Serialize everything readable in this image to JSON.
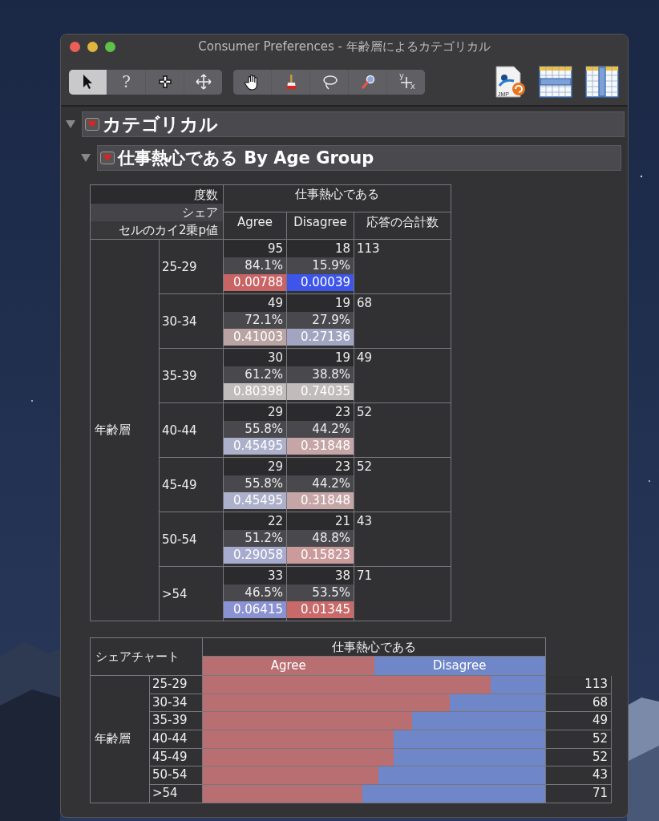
{
  "window": {
    "title": "Consumer Preferences - 年齢層によるカテゴリカル"
  },
  "tool_groups": [
    {
      "tools": [
        {
          "kind": "arrow",
          "selected": true
        },
        {
          "kind": "help",
          "glyph": "?",
          "selected": false
        },
        {
          "kind": "crosshair",
          "selected": false
        },
        {
          "kind": "move",
          "selected": false
        }
      ]
    },
    {
      "tools": [
        {
          "kind": "hand",
          "selected": false
        },
        {
          "kind": "brush",
          "selected": false
        },
        {
          "kind": "lasso",
          "selected": false
        },
        {
          "kind": "magnifier",
          "selected": false
        },
        {
          "kind": "xy",
          "sup": "y",
          "sub": "x",
          "selected": false
        }
      ]
    }
  ],
  "file_icons": [
    {
      "kind": "jmp",
      "label": "JMP"
    },
    {
      "kind": "rows"
    },
    {
      "kind": "columns"
    }
  ],
  "report": {
    "title": "カテゴリカル",
    "expanded": true,
    "section": {
      "title": "仕事熱心である By Age Group",
      "expanded": true
    }
  },
  "contingency_table": {
    "legend": [
      "度数",
      "シェア",
      "セルのカイ2乗p値"
    ],
    "column_header": "仕事熱心である",
    "columns": [
      "Agree",
      "Disagree"
    ],
    "total_header": "応答の合計数",
    "row_header": "年齢層",
    "rows": [
      {
        "label": "25-29",
        "total": "113",
        "cells": [
          {
            "count": "95",
            "share": "84.1%",
            "p_value": "0.00788",
            "color": "#c86464"
          },
          {
            "count": "18",
            "share": "15.9%",
            "p_value": "0.00039",
            "color": "#3d55e8"
          }
        ]
      },
      {
        "label": "30-34",
        "total": "68",
        "cells": [
          {
            "count": "49",
            "share": "72.1%",
            "p_value": "0.41003",
            "color": "#b9a3a3"
          },
          {
            "count": "19",
            "share": "27.9%",
            "p_value": "0.27136",
            "color": "#a2a5c2"
          }
        ]
      },
      {
        "label": "35-39",
        "total": "49",
        "cells": [
          {
            "count": "30",
            "share": "61.2%",
            "p_value": "0.80398",
            "color": "#c0bcbc"
          },
          {
            "count": "19",
            "share": "38.8%",
            "p_value": "0.74035",
            "color": "#c2bbbb"
          }
        ]
      },
      {
        "label": "40-44",
        "total": "52",
        "cells": [
          {
            "count": "29",
            "share": "55.8%",
            "p_value": "0.45495",
            "color": "#adb0ca"
          },
          {
            "count": "23",
            "share": "44.2%",
            "p_value": "0.31848",
            "color": "#c5a5a5"
          }
        ]
      },
      {
        "label": "45-49",
        "total": "52",
        "cells": [
          {
            "count": "29",
            "share": "55.8%",
            "p_value": "0.45495",
            "color": "#adb0ca"
          },
          {
            "count": "23",
            "share": "44.2%",
            "p_value": "0.31848",
            "color": "#c5a5a5"
          }
        ]
      },
      {
        "label": "50-54",
        "total": "43",
        "cells": [
          {
            "count": "22",
            "share": "51.2%",
            "p_value": "0.29058",
            "color": "#a7abcd"
          },
          {
            "count": "21",
            "share": "48.8%",
            "p_value": "0.15823",
            "color": "#cb9b9b"
          }
        ]
      },
      {
        "label": ">54",
        "total": "71",
        "cells": [
          {
            "count": "33",
            "share": "46.5%",
            "p_value": "0.06415",
            "color": "#8a92d2"
          },
          {
            "count": "38",
            "share": "53.5%",
            "p_value": "0.01345",
            "color": "#c86a6a"
          }
        ]
      }
    ]
  },
  "share_chart": {
    "title": "シェアチャート",
    "column_header": "仕事熱心である",
    "legend": [
      {
        "label": "Agree",
        "color": "#b96e72"
      },
      {
        "label": "Disagree",
        "color": "#6f86c8"
      }
    ],
    "row_header": "年齢層",
    "rows": [
      {
        "label": "25-29",
        "level": 0.841,
        "total": "113"
      },
      {
        "label": "30-34",
        "level": 0.721,
        "total": "68"
      },
      {
        "label": "35-39",
        "level": 0.612,
        "total": "49"
      },
      {
        "label": "40-44",
        "level": 0.558,
        "total": "52"
      },
      {
        "label": "45-49",
        "level": 0.558,
        "total": "52"
      },
      {
        "label": "50-54",
        "level": 0.512,
        "total": "43"
      },
      {
        "label": ">54",
        "level": 0.465,
        "total": "71"
      }
    ]
  }
}
